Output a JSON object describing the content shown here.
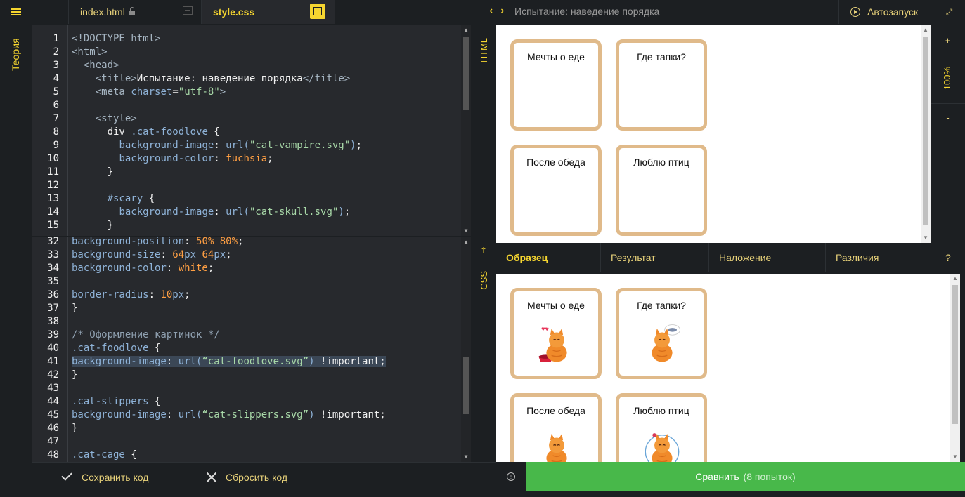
{
  "rail": {
    "theory_label": "Теория"
  },
  "tabs": [
    {
      "label": "index.html"
    },
    {
      "label": "style.css"
    }
  ],
  "editor_html": {
    "side_label": "HTML",
    "lines": [
      {
        "n": "1",
        "html": "<span class=\"t-tag\">&lt;!DOCTYPE html&gt;</span>"
      },
      {
        "n": "2",
        "html": "<span class=\"t-tag\">&lt;html&gt;</span>"
      },
      {
        "n": "3",
        "html": "  <span class=\"t-tag\">&lt;head&gt;</span>"
      },
      {
        "n": "4",
        "html": "    <span class=\"t-tag\">&lt;title&gt;</span>Испытание: наведение порядка<span class=\"t-tag\">&lt;/title&gt;</span>"
      },
      {
        "n": "5",
        "html": "    <span class=\"t-tag\">&lt;meta</span> <span class=\"t-prop\">charset</span>=<span class=\"t-str\">\"utf-8\"</span><span class=\"t-tag\">&gt;</span>"
      },
      {
        "n": "6",
        "html": ""
      },
      {
        "n": "7",
        "html": "    <span class=\"t-tag\">&lt;style&gt;</span>"
      },
      {
        "n": "8",
        "html": "      div <span class=\"t-sel\">.cat-foodlove</span> {"
      },
      {
        "n": "9",
        "html": "        <span class=\"t-prop\">background-image</span>: <span class=\"t-prop\">url(</span><span class=\"t-str\">\"cat-vampire.svg\"</span><span class=\"t-prop\">)</span>;"
      },
      {
        "n": "10",
        "html": "        <span class=\"t-prop\">background-color</span>: <span class=\"t-val\">fuchsia</span>;"
      },
      {
        "n": "11",
        "html": "      }"
      },
      {
        "n": "12",
        "html": ""
      },
      {
        "n": "13",
        "html": "      <span class=\"t-sel\">#scary</span> {"
      },
      {
        "n": "14",
        "html": "        <span class=\"t-prop\">background-image</span>: <span class=\"t-prop\">url(</span><span class=\"t-str\">\"cat-skull.svg\"</span><span class=\"t-prop\">)</span>;"
      },
      {
        "n": "15",
        "html": "      }"
      }
    ]
  },
  "editor_css": {
    "side_label": "CSS",
    "lines": [
      {
        "n": "32",
        "html": "<span class=\"t-prop\">background-position</span>: <span class=\"t-val\">50%</span> <span class=\"t-val\">80%</span>;"
      },
      {
        "n": "33",
        "html": "<span class=\"t-prop\">background-size</span>: <span class=\"t-val\">64</span><span class=\"t-prop\">px</span> <span class=\"t-val\">64</span><span class=\"t-prop\">px</span>;"
      },
      {
        "n": "34",
        "html": "<span class=\"t-prop\">background-color</span>: <span class=\"t-val\">white</span>;"
      },
      {
        "n": "35",
        "html": ""
      },
      {
        "n": "36",
        "html": "<span class=\"t-prop\">border-radius</span>: <span class=\"t-val\">10</span><span class=\"t-prop\">px</span>;"
      },
      {
        "n": "37",
        "html": "}"
      },
      {
        "n": "38",
        "html": ""
      },
      {
        "n": "39",
        "html": "<span class=\"t-com\">/* Оформление картинок */</span>"
      },
      {
        "n": "40",
        "html": "<span class=\"t-sel\">.cat-foodlove</span> {"
      },
      {
        "n": "41",
        "html": "<span class=\"hl\"><span class=\"t-prop\">background-image</span>: <span class=\"t-prop\">url(</span><span class=\"t-str\">“cat-foodlove.svg”</span><span class=\"t-prop\">)</span> !important;</span>"
      },
      {
        "n": "42",
        "html": "}"
      },
      {
        "n": "43",
        "html": ""
      },
      {
        "n": "44",
        "html": "<span class=\"t-sel\">.cat-slippers</span> {"
      },
      {
        "n": "45",
        "html": "<span class=\"t-prop\">background-image</span>: <span class=\"t-prop\">url(</span><span class=\"t-str\">“cat-slippers.svg”</span><span class=\"t-prop\">)</span> !important;"
      },
      {
        "n": "46",
        "html": "}"
      },
      {
        "n": "47",
        "html": ""
      },
      {
        "n": "48",
        "html": "<span class=\"t-sel\">.cat-cage</span> {"
      }
    ]
  },
  "bottom_bar": {
    "save_label": "Сохранить код",
    "reset_label": "Сбросить код"
  },
  "preview": {
    "title": "Испытание: наведение порядка",
    "autorun_label": "Автозапуск",
    "zoom_in": "+",
    "zoom_level": "100%",
    "zoom_out": "-",
    "result_cards": [
      "Мечты о еде",
      "Где тапки?",
      "После обеда",
      "Люблю птиц"
    ],
    "sample_cards": [
      "Мечты о еде",
      "Где тапки?",
      "После обеда",
      "Люблю птиц"
    ]
  },
  "modes": {
    "tabs": [
      "Образец",
      "Результат",
      "Наложение",
      "Различия"
    ],
    "help": "?"
  },
  "compare": {
    "label": "Сравнить",
    "attempts": "(8 попыток)"
  },
  "colors": {
    "accent": "#f5d530",
    "compare_bg": "#48b84a",
    "card_border": "#e0ba8a",
    "editor_bg": "#27292d"
  }
}
